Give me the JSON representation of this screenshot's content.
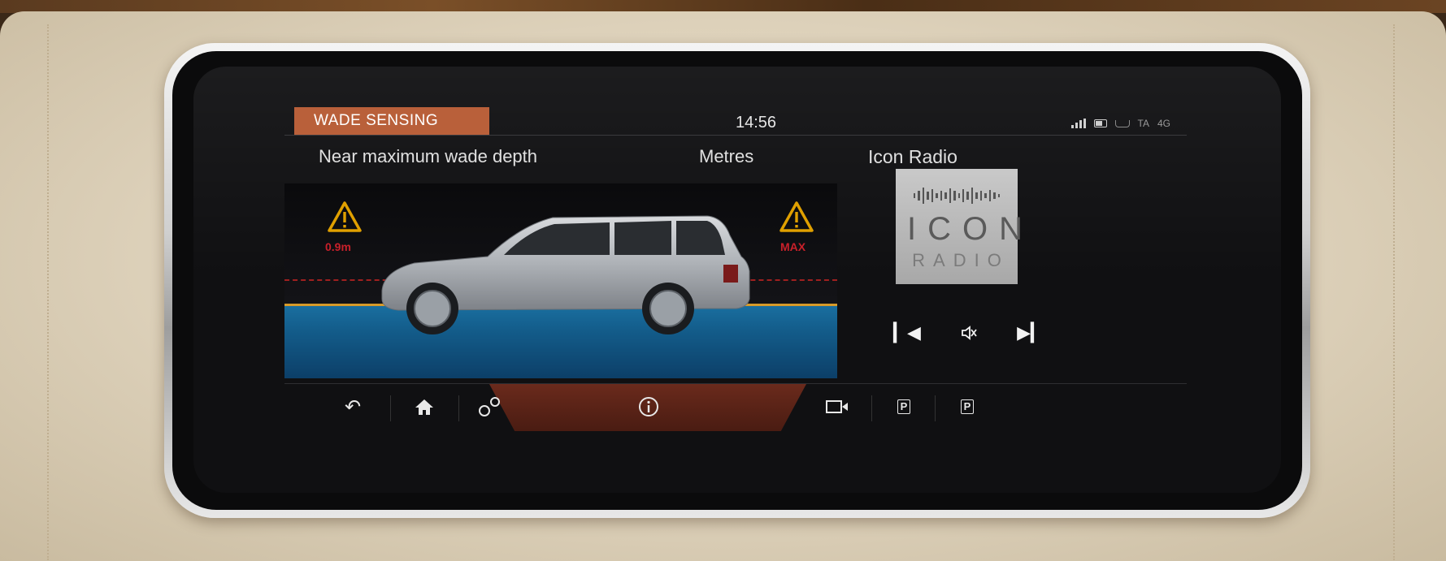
{
  "status_bar": {
    "app_title": "WADE SENSING",
    "clock": "14:56",
    "indicators": {
      "ta": "TA",
      "network": "4G"
    }
  },
  "wade": {
    "status_text": "Near maximum wade depth",
    "unit_label": "Metres",
    "level_label_left": "0.9m",
    "level_label_right": "MAX",
    "depth_fraction": 0.9
  },
  "radio": {
    "title": "Icon Radio",
    "artwork_line1": "ICON",
    "artwork_line2": "RADIO"
  },
  "colors": {
    "accent": "#b9603a",
    "water": "#1a6fa0",
    "warning": "#e0a000",
    "max_line": "#a02020"
  },
  "nav": {
    "icons": [
      "back-icon",
      "home-icon",
      "connections-icon",
      "info-icon",
      "camera-icon",
      "park-assist-icon",
      "park-exit-icon"
    ],
    "park_assist": "P",
    "park_exit": "P"
  }
}
